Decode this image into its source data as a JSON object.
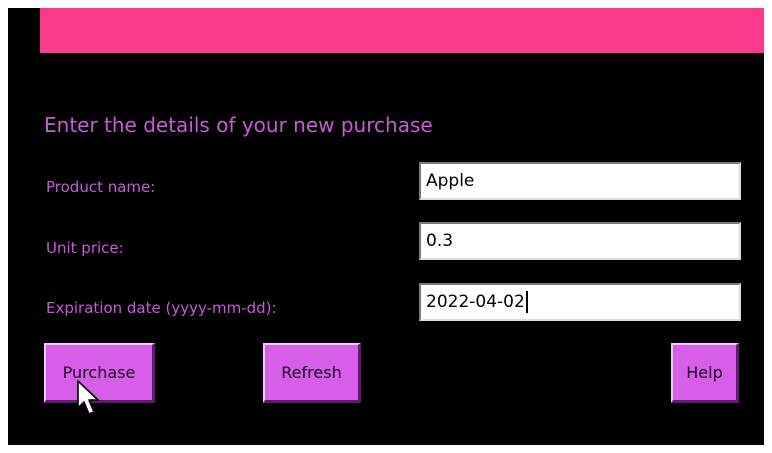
{
  "form": {
    "heading": "Enter the details of your new purchase",
    "fields": [
      {
        "label": "Product name:",
        "value": "Apple"
      },
      {
        "label": "Unit price:",
        "value": "0.3"
      },
      {
        "label": "Expiration date (yyyy-mm-dd):",
        "value": "2022-04-02"
      }
    ]
  },
  "buttons": {
    "purchase": "Purchase",
    "refresh": "Refresh",
    "help": "Help"
  },
  "colors": {
    "banner": "#fb3a8c",
    "text": "#c85bd6",
    "button": "#d65ee8",
    "background": "#000000"
  },
  "icons": {
    "pointer": "mouse-pointer-icon"
  }
}
